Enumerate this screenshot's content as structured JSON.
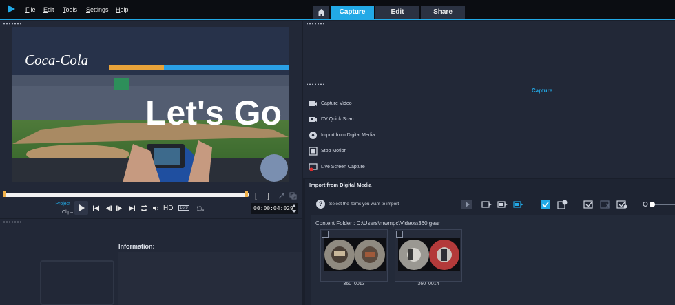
{
  "menu": [
    "File",
    "Edit",
    "Tools",
    "Settings",
    "Help"
  ],
  "tabs": {
    "capture": "Capture",
    "edit": "Edit",
    "share": "Share"
  },
  "player": {
    "overlay_text": "Let's Go",
    "project_label": "Project–",
    "clip_label": "Clip–",
    "hd_label": "HD",
    "aspect_label": "16:9",
    "timecode": "00:00:04:029",
    "bracket_in": "[",
    "bracket_out": "]"
  },
  "library": {
    "info_label": "Information:"
  },
  "capture": {
    "title": "Capture",
    "items": [
      "Capture Video",
      "DV Quick Scan",
      "Import from Digital Media",
      "Stop Motion",
      "Live Screen Capture"
    ]
  },
  "import": {
    "title": "Import from Digital Media",
    "instruction": "Select the items you want to import",
    "content_folder": "Content Folder : C:\\Users\\mwmpc\\Videos\\360 gear",
    "files": [
      "360_0013",
      "360_0014"
    ]
  },
  "colors": {
    "accent": "#22a9e6",
    "panel": "#222837",
    "menubar": "#0b0d12"
  }
}
